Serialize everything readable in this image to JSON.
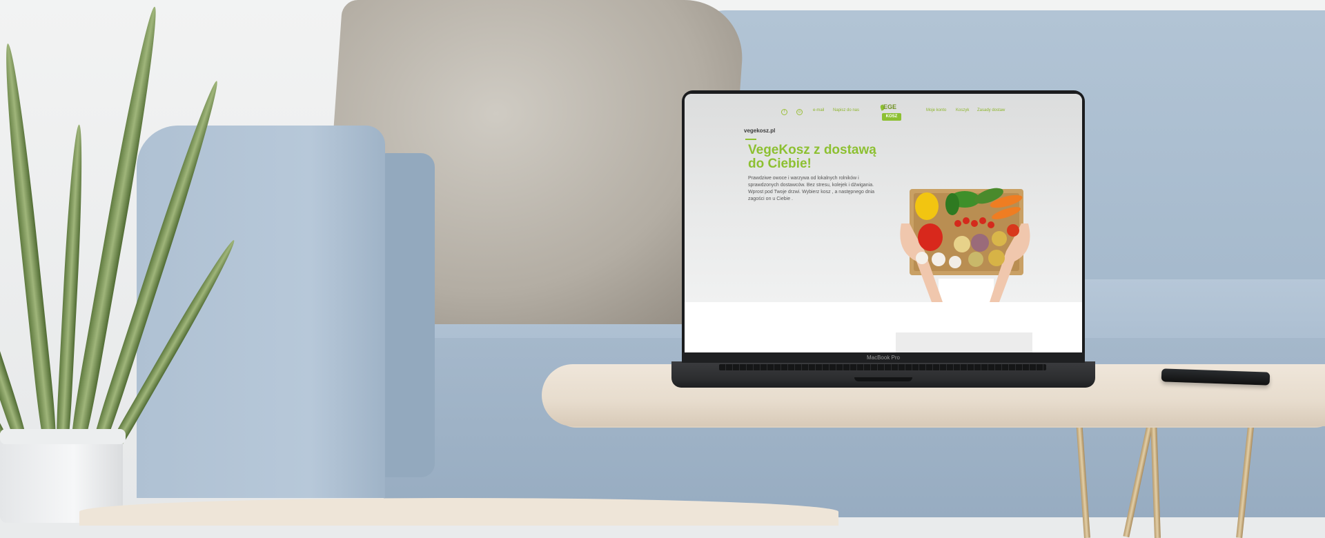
{
  "website": {
    "nav": {
      "facebook_icon": "facebook-icon",
      "instagram_icon": "instagram-icon",
      "link_email": "e-mail",
      "link_contact": "Napisz do nas",
      "link_about": "Moje konto",
      "link_shop": "Koszyk",
      "link_faq": "Zasady dostaw"
    },
    "logo": {
      "top_text": "EGE",
      "box_text": "KOSZ"
    },
    "domain": "vegekosz.pl",
    "hero": {
      "title": "VegeKosz z dostawą do Ciebie!",
      "text": "Prawdziwe owoce i warzywa od lokalnych rolników i sprawdzonych dostawców. Bez stresu, kolejek i dźwigania. Wprost pod Twoje drzwi. Wybierz kosz , a następnego dnia zagości on u Ciebie ."
    },
    "colors": {
      "accent": "#8dc032",
      "text": "#555555"
    }
  },
  "device": {
    "model_label": "MacBook Pro"
  }
}
